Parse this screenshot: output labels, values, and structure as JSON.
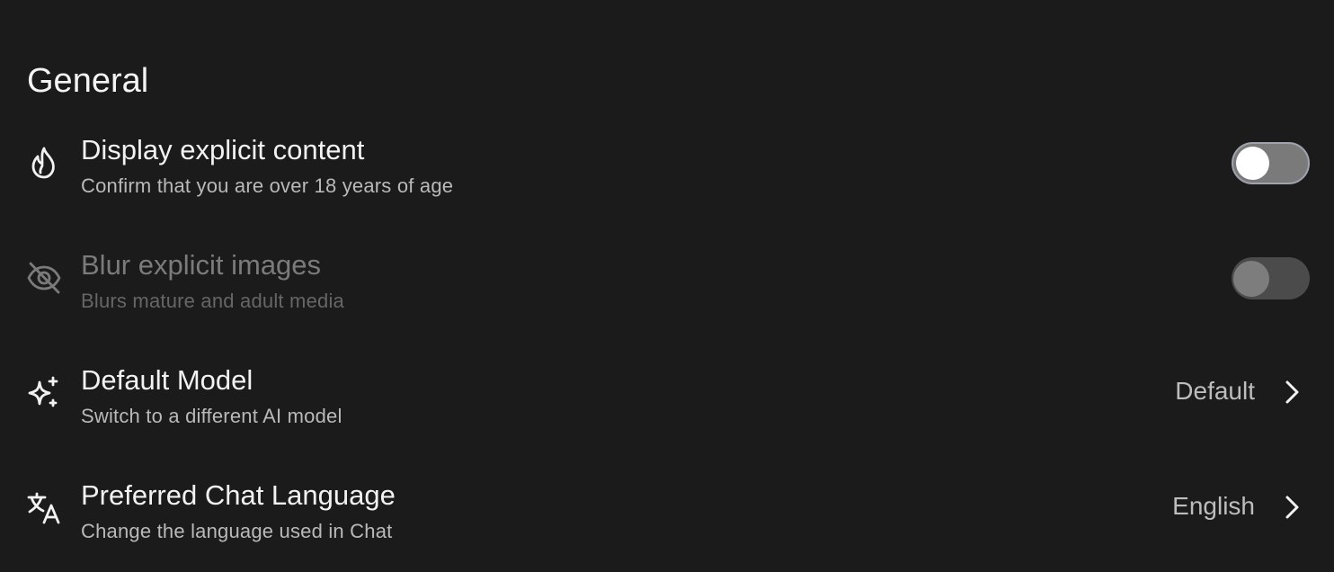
{
  "section": {
    "title": "General"
  },
  "rows": [
    {
      "icon": "flame-icon",
      "title": "Display explicit content",
      "subtitle": "Confirm that you are over 18 years of age",
      "control": "toggle",
      "toggle_on": false,
      "enabled": true
    },
    {
      "icon": "eye-off-icon",
      "title": "Blur explicit images",
      "subtitle": "Blurs mature and adult media",
      "control": "toggle",
      "toggle_on": false,
      "enabled": false
    },
    {
      "icon": "sparkles-icon",
      "title": "Default Model",
      "subtitle": "Switch to a different AI model",
      "control": "navigation",
      "value": "Default",
      "enabled": true
    },
    {
      "icon": "translate-icon",
      "title": "Preferred Chat Language",
      "subtitle": "Change the language used in Chat",
      "control": "navigation",
      "value": "English",
      "enabled": true
    }
  ],
  "colors": {
    "background": "#1b1b1b",
    "text_primary": "#f2f2f2",
    "text_secondary": "#b9b9b9",
    "text_disabled": "#7b7b7b",
    "toggle_track": "#7a7a7a",
    "toggle_track_disabled": "#4b4b4b",
    "toggle_border": "#9ea3ad"
  }
}
